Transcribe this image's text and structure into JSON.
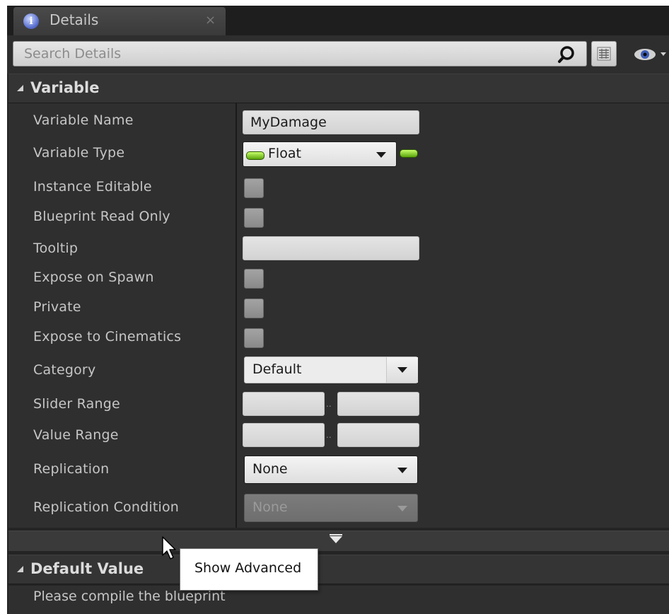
{
  "tab": {
    "title": "Details",
    "close": "×",
    "icon": "info-icon"
  },
  "search": {
    "placeholder": "Search Details",
    "value": ""
  },
  "toolbar": {
    "view_options_icon": "grid-icon",
    "visibility_icon": "eye-icon"
  },
  "variable_section": {
    "title": "Variable",
    "rows": [
      {
        "label": "Variable Name",
        "control": "text",
        "value": "MyDamage"
      },
      {
        "label": "Variable Type",
        "control": "type-dropdown",
        "value": "Float",
        "pin_color": "#7ad21e"
      },
      {
        "label": "Instance Editable",
        "control": "checkbox",
        "checked": false
      },
      {
        "label": "Blueprint Read Only",
        "control": "checkbox",
        "checked": false
      },
      {
        "label": "Tooltip",
        "control": "text",
        "value": ""
      },
      {
        "label": "Expose on Spawn",
        "control": "checkbox",
        "checked": false
      },
      {
        "label": "Private",
        "control": "checkbox",
        "checked": false
      },
      {
        "label": "Expose to Cinematics",
        "control": "checkbox",
        "checked": false
      },
      {
        "label": "Category",
        "control": "combo",
        "value": "Default"
      },
      {
        "label": "Slider Range",
        "control": "range",
        "separator": "..",
        "min": "",
        "max": ""
      },
      {
        "label": "Value Range",
        "control": "range",
        "separator": "..",
        "min": "",
        "max": ""
      },
      {
        "label": "Replication",
        "control": "dropdown",
        "value": "None"
      },
      {
        "label": "Replication Condition",
        "control": "dropdown-disabled",
        "value": "None"
      }
    ]
  },
  "advanced": {
    "tooltip": "Show Advanced"
  },
  "default_value_section": {
    "title": "Default Value",
    "message": "Please compile the blueprint"
  },
  "colors": {
    "panel_bg": "#242424",
    "row_bg": "#2f2f2f",
    "header_bg": "#343434",
    "label_text": "#c6c6c6",
    "float_pin": "#7ad21e"
  }
}
